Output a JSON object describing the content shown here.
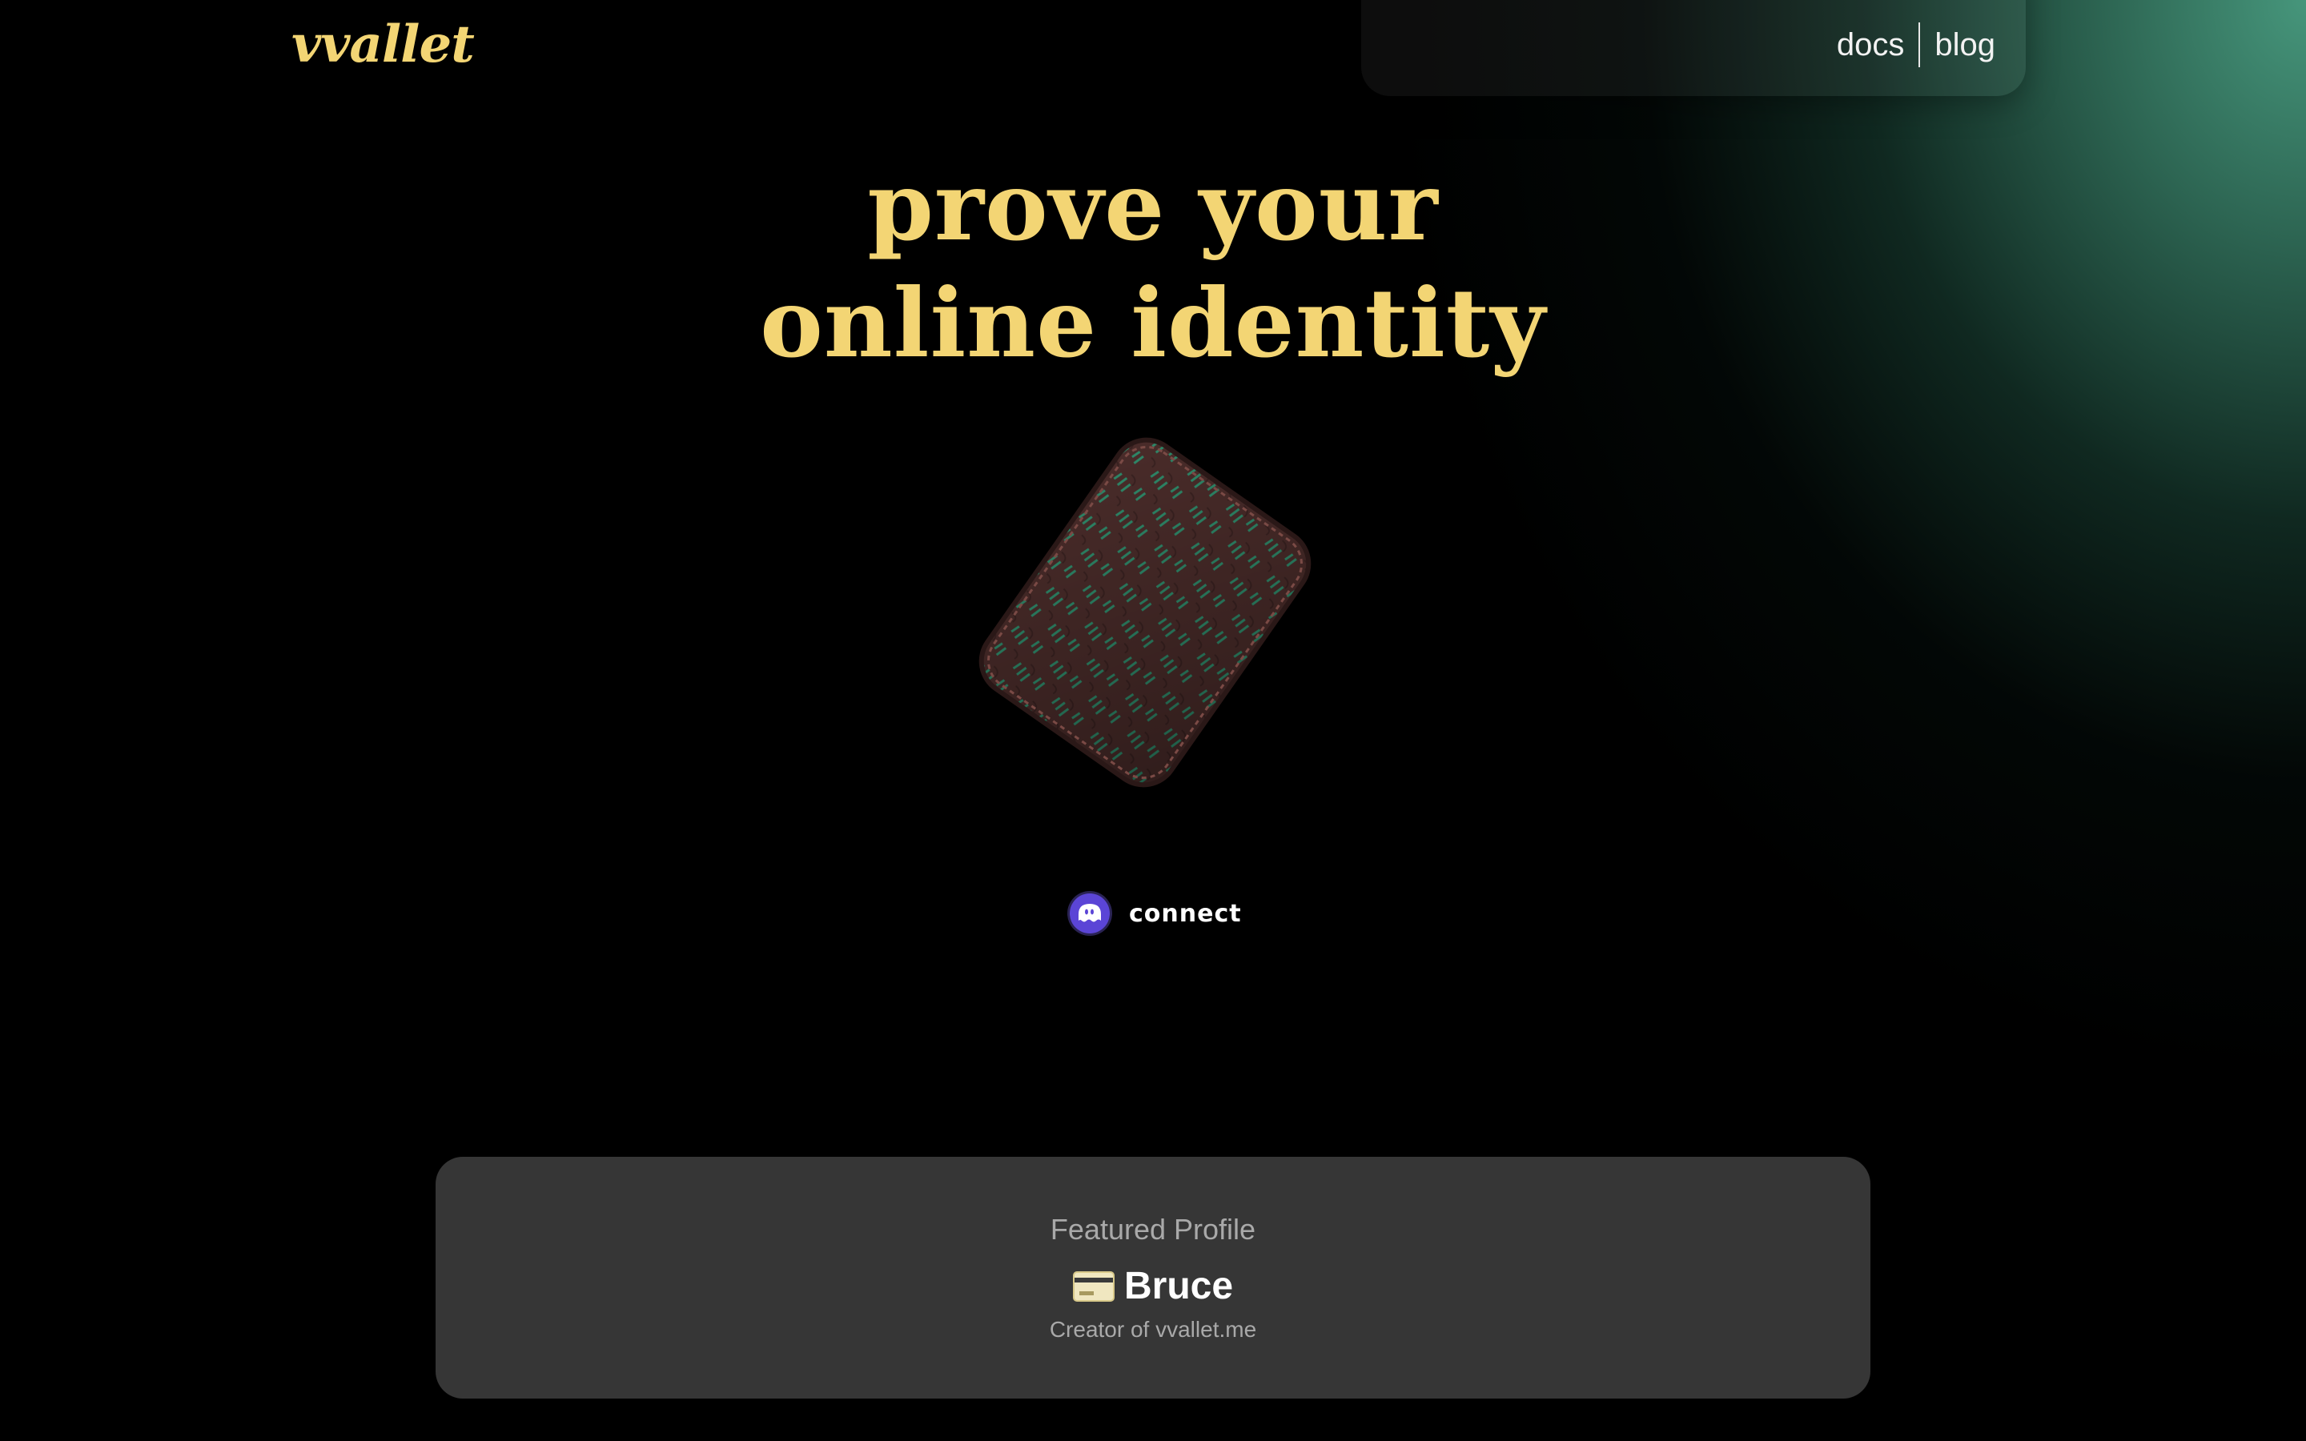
{
  "brand": {
    "logo_text": "vvallet",
    "accent_color": "#f3d574"
  },
  "nav": {
    "docs_label": "docs",
    "blog_label": "blog"
  },
  "hero": {
    "headline_line1": "prove your",
    "headline_line2": "online identity",
    "image": "wallet-3d-illustration"
  },
  "connect": {
    "label": "connect",
    "icon": "phantom-ghost-icon"
  },
  "featured": {
    "kicker": "Featured Profile",
    "icon": "credit-card-icon",
    "name": "Bruce",
    "subtitle": "Creator of vvallet.me"
  },
  "colors": {
    "background": "#000000",
    "glow": "#4a9e82",
    "card_bg": "#363636",
    "connect_icon_bg": "#5b45d6"
  }
}
